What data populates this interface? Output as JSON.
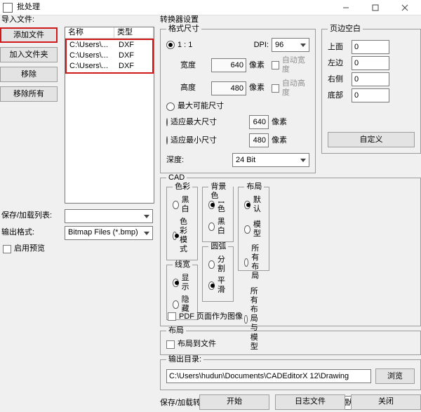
{
  "window": {
    "title": "批处理",
    "minimize_icon": "minimize",
    "maximize_icon": "maximize",
    "close_icon": "close"
  },
  "left": {
    "import_label": "导入文件:",
    "buttons": {
      "add_file": "添加文件",
      "add_folder": "加入文件夹",
      "remove": "移除",
      "remove_all": "移除所有"
    },
    "columns": {
      "name": "名称",
      "type": "类型"
    },
    "rows": [
      {
        "name": "C:\\Users\\...",
        "type": "DXF"
      },
      {
        "name": "C:\\Users\\...",
        "type": "DXF"
      },
      {
        "name": "C:\\Users\\...",
        "type": "DXF"
      }
    ],
    "save_load_list": "保存/加载列表:",
    "save_load_value": "",
    "output_fmt_label": "输出格式:",
    "output_fmt_value": "Bitmap Files (*.bmp)",
    "enable_preview": "启用预览"
  },
  "converter": {
    "group": "转换器设置",
    "size": {
      "group": "格式尺寸",
      "one_to_one": "1 : 1",
      "dpi_label": "DPI:",
      "dpi_value": "96",
      "width_label": "宽度",
      "width_value": "640",
      "width_unit": "像素",
      "auto_width": "自动宽度",
      "height_label": "高度",
      "height_value": "480",
      "height_unit": "像素",
      "auto_height": "自动高度",
      "max_possible": "最大可能尺寸",
      "fit_max": "适应最大尺寸",
      "fit_max_value": "640",
      "fit_max_unit": "像素",
      "fit_min": "适应最小尺寸",
      "fit_min_value": "480",
      "fit_min_unit": "像素",
      "depth_label": "深度:",
      "depth_value": "24 Bit"
    },
    "margins": {
      "group": "页边空白",
      "top": "上面",
      "top_v": "0",
      "left": "左边",
      "left_v": "0",
      "right": "右侧",
      "right_v": "0",
      "bottom": "底部",
      "bottom_v": "0",
      "custom": "自定义"
    },
    "cad": {
      "group": "CAD",
      "color": {
        "legend": "色彩",
        "bw": "黑白",
        "color": "色彩模式"
      },
      "bg": {
        "legend": "背景色",
        "white": "白色",
        "black": "黑白"
      },
      "lw": {
        "legend": "线宽",
        "show": "显示",
        "hide": "隐藏"
      },
      "arc": {
        "legend": "圆弧",
        "split": "分割",
        "smooth": "平滑"
      },
      "layout": {
        "legend": "布局",
        "default": "默认",
        "model": "模型",
        "all": "所有布局",
        "allm": "所有布局与模型"
      },
      "pdf_page_image": "PDF 页面作为图像"
    },
    "layout": {
      "group": "布局",
      "layout_to_file": "布局到文件"
    },
    "outdir": {
      "label": "输出目录:",
      "value": "C:\\Users\\hudun\\Documents\\CADEditorX 12\\Drawing",
      "browse": "浏览"
    },
    "save_settings_label": "保存/加载转换设置 :",
    "save_settings_value": "<默认>"
  },
  "footer": {
    "start": "开始",
    "log": "日志文件",
    "close": "关闭"
  }
}
